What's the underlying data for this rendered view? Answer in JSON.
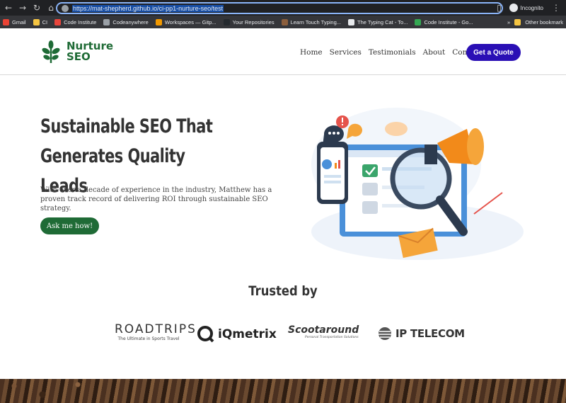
{
  "browser": {
    "url": "https://mat-shepherd.github.io/ci-pp1-nurture-seo/test",
    "profile_label": "Incognito",
    "bookmarks": [
      {
        "label": "Gmail",
        "color": "#ea4335"
      },
      {
        "label": "CI",
        "color": "#f5c542"
      },
      {
        "label": "Code Institute",
        "color": "#e8453c"
      },
      {
        "label": "Codeanywhere",
        "color": "#9aa0a6"
      },
      {
        "label": "Workspaces — Gitp...",
        "color": "#f29900"
      },
      {
        "label": "Your Repositories",
        "color": "#24292e"
      },
      {
        "label": "Learn Touch Typing...",
        "color": "#8b5e3c"
      },
      {
        "label": "The Typing Cat - To...",
        "color": "#e8eaed"
      },
      {
        "label": "Code Institute - Go...",
        "color": "#34a853"
      }
    ],
    "other_bookmarks": "Other bookmark"
  },
  "site": {
    "logo_line1": "Nurture",
    "logo_line2": "SEO",
    "nav": [
      "Home",
      "Services",
      "Testimonials",
      "About",
      "Contact"
    ],
    "cta": "Get a Quote",
    "hero_title_line1": "Sustainable SEO That",
    "hero_title_line2": "Generates Quality Leads",
    "hero_text": "With over a decade of experience in the industry, Matthew has a proven track record of delivering ROI through sustainable SEO strategy.",
    "hero_button": "Ask me how!",
    "trusted_heading": "Trusted by",
    "logos": {
      "roadtrips": "ROADTRIPS",
      "roadtrips_tagline": "The Ultimate in Sports Travel",
      "iqmetrix": "iQmetrix",
      "scootaround": "Scootaround",
      "scootaround_tagline": "Personal Transportation Solutions",
      "iptelecom": "IP TELECOM"
    }
  },
  "colors": {
    "brand_green": "#1f6b36",
    "cta_blue": "#2a0fb5",
    "chrome_dark": "#202124"
  }
}
